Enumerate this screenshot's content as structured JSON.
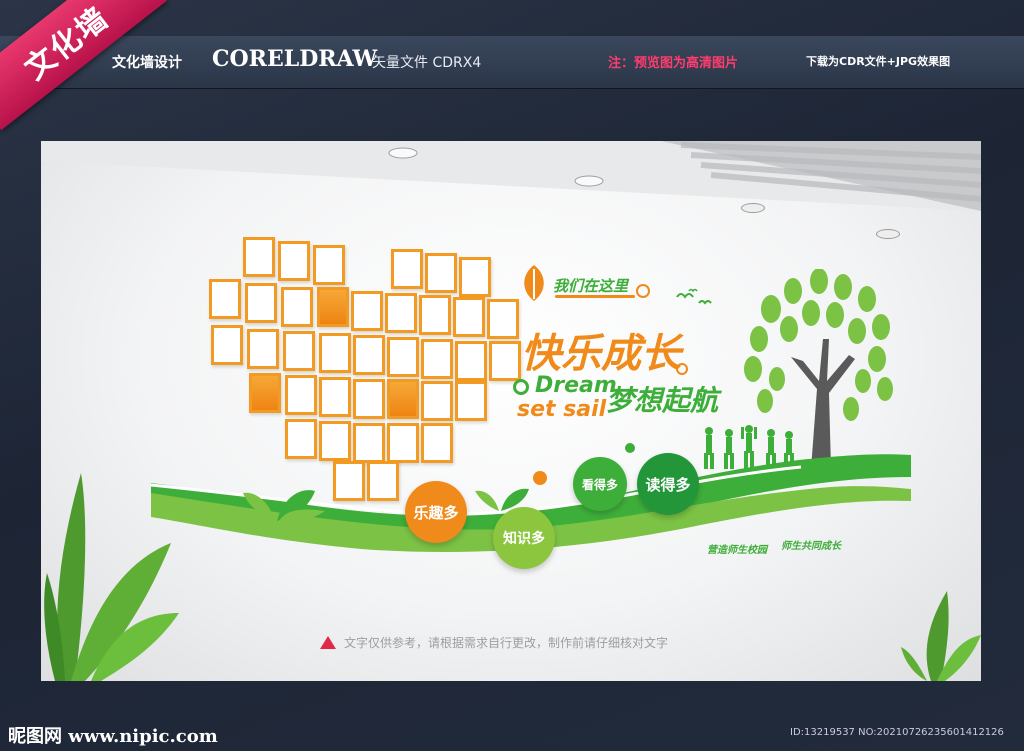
{
  "header": {
    "ribbon_label": "文化墙",
    "design_label": "文化墙设计",
    "software_label": "CORELDRAW",
    "file_label": "矢量文件 CDRX4",
    "note_label": "注：预览图为高清图片",
    "download_label": "下载为CDR文件+JPG效果图"
  },
  "wall": {
    "slogan_small": "我们在这里",
    "slogan_main": "快乐成长",
    "slogan_en_line1": "Dream",
    "slogan_en_line2": "set sail",
    "slogan_cn2": "梦想起航",
    "bubbles": [
      "乐趣多",
      "知识多",
      "看得多",
      "读得多"
    ],
    "wave_text_1": "营造师生校园",
    "wave_text_2": "师生共同成长",
    "disclaimer": "文字仅供参考，请根据需求自行更改，制作前请仔细核对文字"
  },
  "colors": {
    "orange": "#f08a1a",
    "green": "#3eae3a",
    "red": "#e0294a"
  },
  "footer": {
    "site": "昵图网 www.nipic.com",
    "id_text": "ID:13219537 NO:20210726235601412126"
  }
}
